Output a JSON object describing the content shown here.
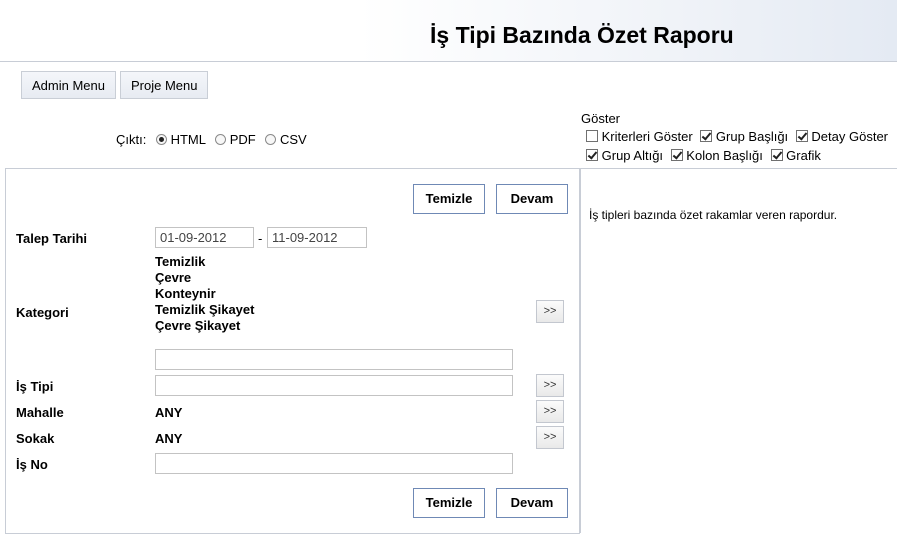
{
  "header": {
    "title": "İş Tipi Bazında Özet Raporu"
  },
  "nav": {
    "admin_menu": "Admin Menu",
    "proje_menu": "Proje Menu"
  },
  "output": {
    "label": "Çıktı:",
    "options": [
      {
        "label": "HTML",
        "selected": true
      },
      {
        "label": "PDF",
        "selected": false
      },
      {
        "label": "CSV",
        "selected": false
      }
    ]
  },
  "show": {
    "label": "Göster",
    "options": [
      {
        "label": "Kriterleri Göster",
        "checked": false
      },
      {
        "label": "Grup Başlığı",
        "checked": true
      },
      {
        "label": "Detay Göster",
        "checked": true
      },
      {
        "label": "Grup Altığı",
        "checked": true
      },
      {
        "label": "Kolon Başlığı",
        "checked": true
      },
      {
        "label": "Grafik",
        "checked": true
      }
    ]
  },
  "form": {
    "clear_label": "Temizle",
    "continue_label": "Devam",
    "picker_label": ">>",
    "talep_tarihi": {
      "label": "Talep Tarihi",
      "from": "01-09-2012",
      "separator": "-",
      "to": "11-09-2012"
    },
    "kategori": {
      "label": "Kategori",
      "items": [
        "Temizlik",
        "Çevre",
        "Konteynir",
        "Temizlik Şikayet",
        "Çevre Şikayet"
      ],
      "input_value": ""
    },
    "is_tipi": {
      "label": "İş Tipi",
      "value": ""
    },
    "mahalle": {
      "label": "Mahalle",
      "value": "ANY"
    },
    "sokak": {
      "label": "Sokak",
      "value": "ANY"
    },
    "is_no": {
      "label": "İş No",
      "value": ""
    }
  },
  "info": {
    "description": "İş tipleri bazında özet rakamlar veren rapordur."
  }
}
